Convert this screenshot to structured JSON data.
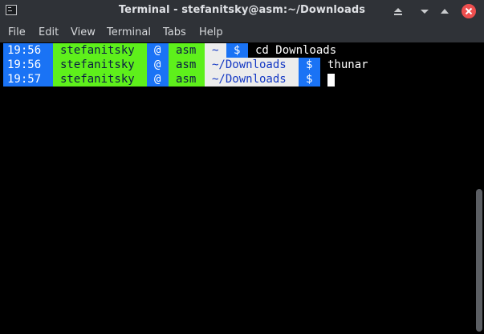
{
  "window": {
    "title": "Terminal - stefanitsky@asm:~/Downloads",
    "icons": [
      "terminal-app-icon",
      "shade-icon",
      "minimize-icon",
      "maximize-icon",
      "close-icon"
    ]
  },
  "menu": {
    "items": [
      "File",
      "Edit",
      "View",
      "Terminal",
      "Tabs",
      "Help"
    ]
  },
  "colors": {
    "prompt_blue": "#1a73f5",
    "prompt_green": "#5ef01b",
    "prompt_gray": "#ececec",
    "path_text": "#1438c4",
    "close_red": "#ee4f4f"
  },
  "terminal": {
    "lines": [
      {
        "time": "19:56",
        "user": "stefanitsky",
        "at": "@",
        "host": "asm",
        "path": "~",
        "dollar": "$",
        "command": "cd Downloads"
      },
      {
        "time": "19:56",
        "user": "stefanitsky",
        "at": "@",
        "host": "asm",
        "path": "~/Downloads",
        "dollar": "$",
        "command": "thunar"
      },
      {
        "time": "19:57",
        "user": "stefanitsky",
        "at": "@",
        "host": "asm",
        "path": "~/Downloads",
        "dollar": "$",
        "command": ""
      }
    ]
  }
}
